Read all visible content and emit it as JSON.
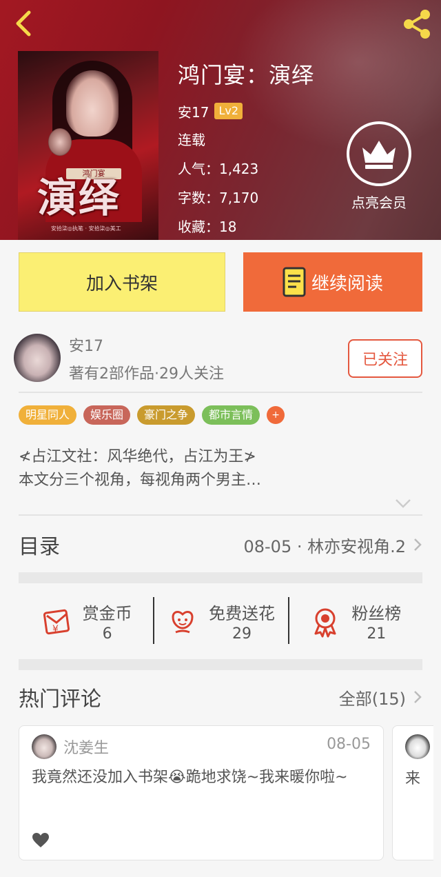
{
  "header": {
    "book_title": "鸿门宴：演绎",
    "author": "安17",
    "level": "Lv2",
    "status": "连载",
    "popularity": "人气：1,423",
    "word_count": "字数：7,170",
    "favorites": "收藏：18",
    "vip_label": "点亮会员",
    "cover_art": {
      "title_text": "演绎",
      "banner_text": "鸿门宴",
      "credit_text": "安拾柒◎执笔  ·  安拾柒◎美工"
    }
  },
  "actions": {
    "add_to_shelf": "加入书架",
    "continue_reading": "继续阅读"
  },
  "author_card": {
    "name": "安17",
    "stats": "著有2部作品·29人关注",
    "follow_label": "已关注"
  },
  "tags": [
    {
      "label": "明星同人",
      "color": "#f0b03a"
    },
    {
      "label": "娱乐圈",
      "color": "#c8665a"
    },
    {
      "label": "豪门之争",
      "color": "#c99b2e"
    },
    {
      "label": "都市言情",
      "color": "#7cbf5a"
    }
  ],
  "tags_more": "+",
  "description": {
    "line1": "≮占江文社：风华绝代，占江为王≯",
    "line2": "本文分三个视角，每视角两个男主…"
  },
  "toc": {
    "title": "目录",
    "latest": "08-05 · 林亦安视角.2"
  },
  "stats": [
    {
      "label": "赏金币",
      "value": "6",
      "icon": "red-envelope-icon"
    },
    {
      "label": "免费送花",
      "value": "29",
      "icon": "flower-icon"
    },
    {
      "label": "粉丝榜",
      "value": "21",
      "icon": "medal-icon"
    }
  ],
  "comments_section": {
    "title": "热门评论",
    "all_label": "全部(15)"
  },
  "comments": [
    {
      "user": "沈姜生",
      "date": "08-05",
      "text": "我竟然还没加入书架😭跪地求饶~我来暖你啦~"
    },
    {
      "text": "来"
    }
  ],
  "colors": {
    "accent": "#f06a3a",
    "shelf_button": "#fbef73",
    "follow_red": "#e4573e"
  }
}
